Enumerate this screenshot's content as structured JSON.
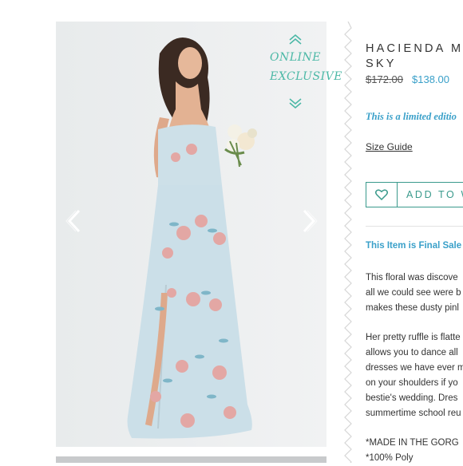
{
  "gallery": {
    "badge_line1": "ONLINE",
    "badge_line2": "EXCLUSIVE",
    "badge_icon_top": "chevron-up-icon",
    "badge_icon_bottom": "chevron-down-icon",
    "prev_icon": "chevron-left-icon",
    "next_icon": "chevron-right-icon"
  },
  "product": {
    "title_line1": "HACIENDA M",
    "title_line2": "SKY",
    "price_old": "$172.00",
    "price_new": "$138.00",
    "limited_text": "This is a limited editio",
    "size_guide": "Size Guide",
    "wishlist_label": "ADD TO W",
    "wishlist_icon": "heart-icon",
    "final_sale": "This Item is Final Sale",
    "desc1": [
      "This floral was discove",
      "all we could see were b",
      "makes these dusty pinl"
    ],
    "desc2": [
      "Her pretty ruffle is flatte",
      "allows you to dance all",
      "dresses we have ever m",
      "on your shoulders if yo",
      "bestie's wedding. Dres",
      "summertime school reu"
    ],
    "desc3": [
      "*MADE IN THE GORG",
      "*100% Poly"
    ]
  },
  "colors": {
    "accent_blue": "#3aa0c9",
    "accent_teal": "#4bb8a6",
    "dress": "#cfe0e8"
  }
}
